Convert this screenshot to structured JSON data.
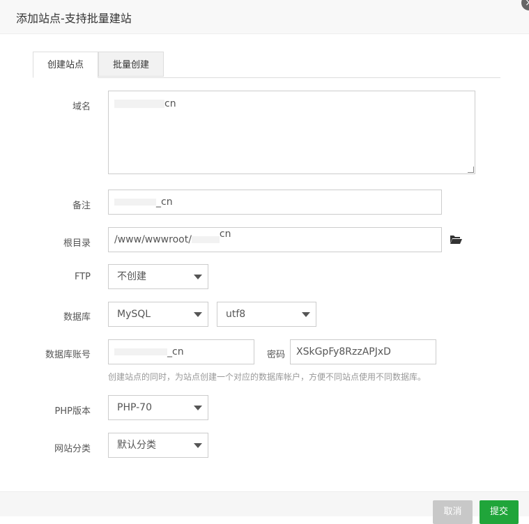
{
  "dialog": {
    "title": "添加站点-支持批量建站",
    "close_glyph": "×"
  },
  "tabs": [
    {
      "label": "创建站点",
      "active": true
    },
    {
      "label": "批量创建",
      "active": false
    }
  ],
  "form": {
    "domain": {
      "label": "域名",
      "value": "cn"
    },
    "remark": {
      "label": "备注",
      "value": "_cn"
    },
    "root_dir": {
      "label": "根目录",
      "value": "/www/wwwroot/",
      "suffix": "cn"
    },
    "ftp": {
      "label": "FTP",
      "selected": "不创建"
    },
    "database": {
      "label": "数据库",
      "type_selected": "MySQL",
      "charset_selected": "utf8"
    },
    "db_account": {
      "label": "数据库账号",
      "value": "_cn",
      "password_label": "密码",
      "password_value": "XSkGpFy8RzzAPJxD"
    },
    "db_hint": "创建站点的同时，为站点创建一个对应的数据库帐户，方便不同站点使用不同数据库。",
    "php_version": {
      "label": "PHP版本",
      "selected": "PHP-70"
    },
    "category": {
      "label": "网站分类",
      "selected": "默认分类"
    }
  },
  "footer": {
    "cancel_label": "取消",
    "submit_label": "提交"
  },
  "colors": {
    "submit": "#20a53a",
    "cancel": "#c8c8c8"
  }
}
